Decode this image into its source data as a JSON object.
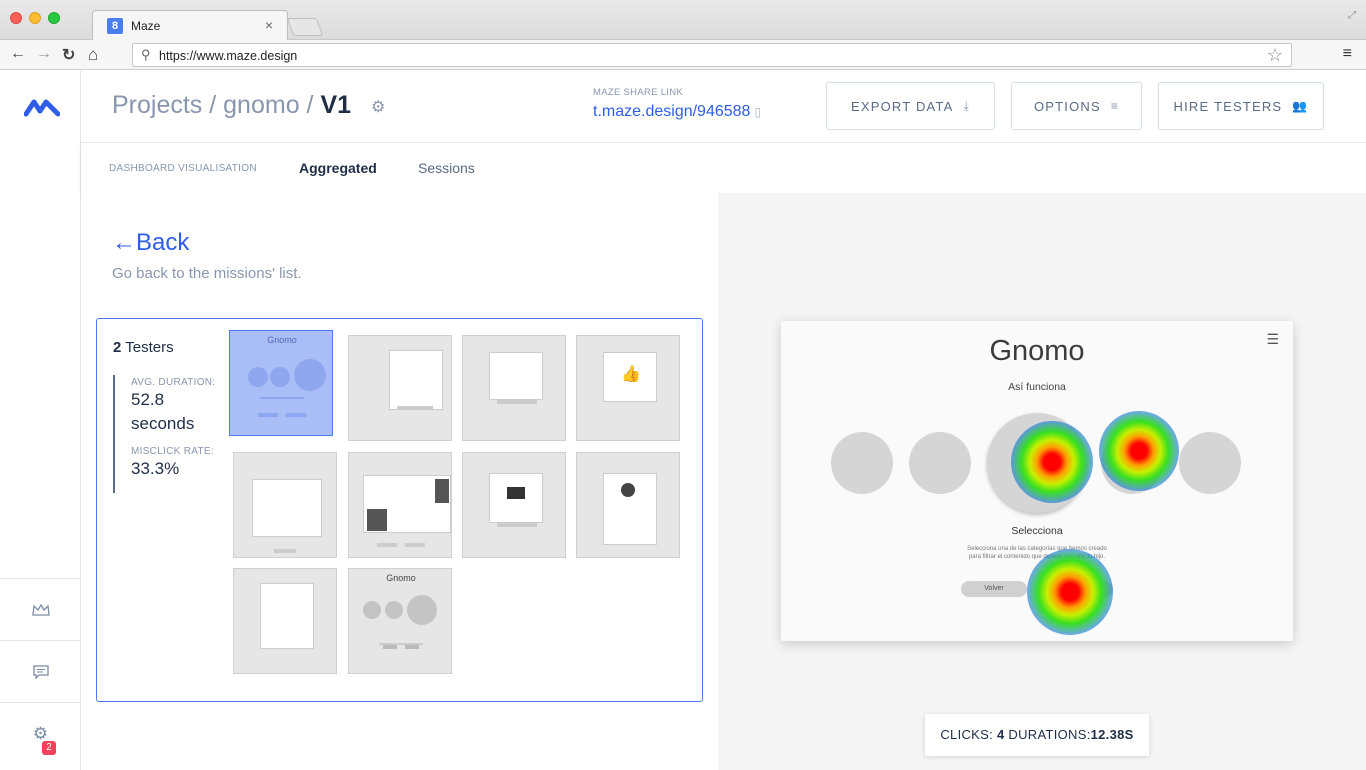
{
  "browser": {
    "tab_title": "Maze",
    "tab_close": "×",
    "url": "https://www.maze.design",
    "favicon": "8"
  },
  "header": {
    "crumb_projects": "Projects",
    "crumb_sep": " / ",
    "crumb_project": "gnomo",
    "crumb_version": "V1",
    "share_label": "MAZE SHARE LINK",
    "share_link": "t.maze.design/946588",
    "export_label": "EXPORT DATA",
    "options_label": "OPTIONS",
    "hire_label": "HIRE TESTERS"
  },
  "subnav": {
    "label": "DASHBOARD VISUALISATION",
    "tab_aggregated": "Aggregated",
    "tab_sessions": "Sessions"
  },
  "back": {
    "label": "Back",
    "arrow": "←",
    "subtitle": "Go back to the missions' list."
  },
  "stats": {
    "testers_count": "2",
    "testers_label": "Testers",
    "duration_label": "AVG. DURATION:",
    "duration_value": "52.8",
    "duration_unit": "seconds",
    "misclick_label": "MISCLICK RATE:",
    "misclick_value": "33.3%"
  },
  "prototype": {
    "title": "Gnomo",
    "subtitle": "Así funciona",
    "select_title": "Selecciona",
    "description": "Selecciona una de las categorías que hemos creado para filtrar el contenido que deseas leer con tu hijo.",
    "back_button": "Volver"
  },
  "metrics": {
    "clicks_label": "CLICKS:",
    "clicks_value": "4",
    "durations_label": "DURATIONS:",
    "durations_value": "12.38S"
  },
  "sidebar": {
    "notification_count": "2"
  },
  "colors": {
    "accent": "#2e5ee8",
    "panel_border": "#4b7df0",
    "text_dark": "#1f2d46",
    "text_muted": "#8996ad"
  }
}
